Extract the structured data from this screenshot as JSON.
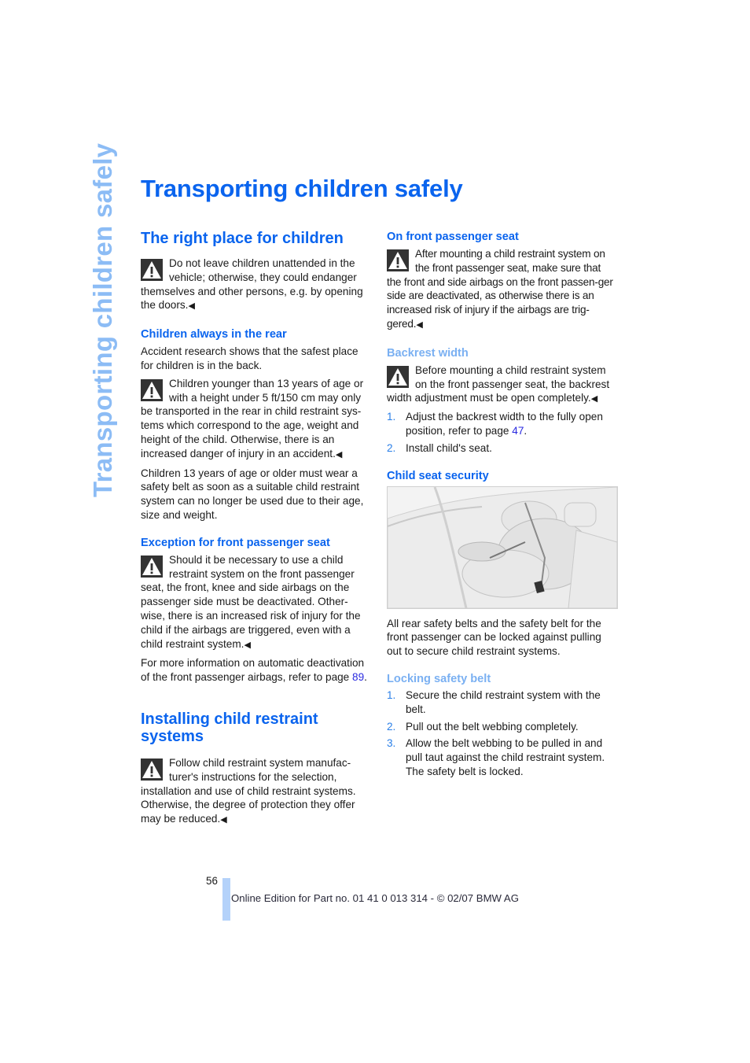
{
  "side_title": "Transporting children safely",
  "page_title": "Transporting children safely",
  "left_column": {
    "section1_heading": "The right place for children",
    "warning1": "Do not leave children unattended in the vehicle; otherwise, they could endanger themselves and other persons, e.g. by opening the doors.",
    "sub1_heading": "Children always in the rear",
    "sub1_text": "Accident research shows that the safest place for children is in the back.",
    "warning2": "Children younger than 13 years of age or with a height under 5 ft/150 cm may only be transported in the rear in child restraint sys-tems which correspond to the age, weight and height of the child. Otherwise, there is an increased danger of injury in an accident.",
    "sub1_text2": "Children 13 years of age or older must wear a safety belt as soon as a suitable child restraint system can no longer be used due to their age, size and weight.",
    "sub2_heading": "Exception for front passenger seat",
    "warning3": "Should it be necessary to use a child restraint system on the front passenger seat, the front, knee and side airbags on the passenger side must be deactivated. Other-wise, there is an increased risk of injury for the child if the airbags are triggered, even with a child restraint system.",
    "sub2_text_before": "For more information on automatic deactivation of the front passenger airbags, refer to page ",
    "sub2_link": "89",
    "sub2_text_after": ".",
    "section2_heading": "Installing child restraint systems",
    "warning4": "Follow child restraint system manufac-turer's instructions for the selection, installation and use of child restraint systems. Otherwise, the degree of protection they offer may be reduced."
  },
  "right_column": {
    "sub3_heading": "On front passenger seat",
    "warning5": "After mounting a child restraint system on the front passenger seat, make sure that the front and side airbags on the front passen-ger side are deactivated, as otherwise there is an increased risk of injury if the airbags are trig-gered.",
    "sub4_heading": "Backrest width",
    "warning6": "Before mounting a child restraint system on the front passenger seat, the backrest width adjustment must be open completely.",
    "steps1": [
      {
        "num": "1.",
        "text_before": "Adjust the backrest width to the fully open position, refer to page ",
        "link": "47",
        "text_after": "."
      },
      {
        "num": "2.",
        "text": "Install child's seat."
      }
    ],
    "sub5_heading": "Child seat security",
    "figure_alt": "Illustration of child seat secured on rear seat with safety belt",
    "sub5_text": "All rear safety belts and the safety belt for the front passenger can be locked against pulling out to secure child restraint systems.",
    "sub6_heading": "Locking safety belt",
    "steps2": [
      {
        "num": "1.",
        "text": "Secure the child restraint system with the belt."
      },
      {
        "num": "2.",
        "text": "Pull out the belt webbing completely."
      },
      {
        "num": "3.",
        "text": "Allow the belt webbing to be pulled in and pull taut against the child restraint system. The safety belt is locked."
      }
    ]
  },
  "end_mark": "◀",
  "icons": {
    "warning": "warning-triangle-icon"
  },
  "footer": {
    "page_number": "56",
    "text": "Online Edition for Part no. 01 41 0 013 314 - © 02/07 BMW AG"
  },
  "colors": {
    "heading": "#0a64ee",
    "subheading_light": "#7ab0f2",
    "side_title": "#8cbcf5",
    "footer_bar": "#b4d2fa",
    "link": "#2a2ae0"
  }
}
